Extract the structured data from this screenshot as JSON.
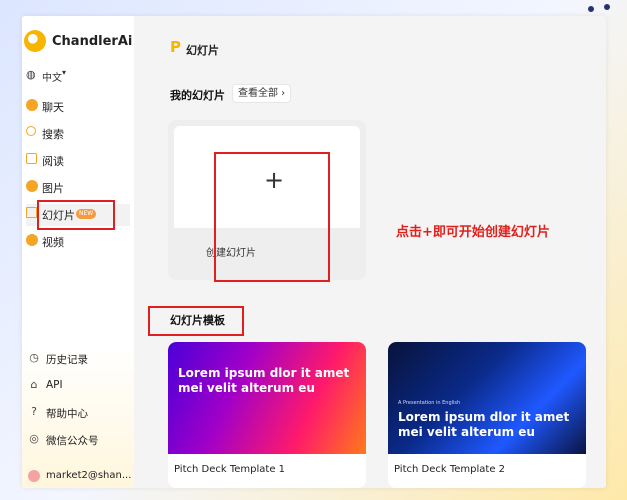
{
  "app": {
    "name": "ChandlerAi",
    "language": "中文"
  },
  "sidebar": {
    "items": [
      {
        "label": "聊天",
        "icon": "chat-icon"
      },
      {
        "label": "搜索",
        "icon": "search-icon"
      },
      {
        "label": "阅读",
        "icon": "book-icon"
      },
      {
        "label": "图片",
        "icon": "image-icon"
      },
      {
        "label": "幻灯片",
        "icon": "slides-icon",
        "badge": "NEW"
      },
      {
        "label": "视频",
        "icon": "video-icon"
      }
    ],
    "bottom": [
      {
        "label": "历史记录",
        "icon": "history-icon"
      },
      {
        "label": "API",
        "icon": "api-icon"
      },
      {
        "label": "帮助中心",
        "icon": "help-icon"
      },
      {
        "label": "微信公众号",
        "icon": "wechat-icon"
      }
    ],
    "user": "market2@shan..."
  },
  "main": {
    "title": "幻灯片",
    "my_section": "我的幻灯片",
    "view_all": "查看全部 ›",
    "create_label": "创建幻灯片",
    "hint": "点击+即可开始创建幻灯片",
    "templates_section": "幻灯片模板",
    "templates": [
      {
        "heading": "Lorem ipsum dlor it amet mei velit alterum eu",
        "name": "Pitch Deck Template 1"
      },
      {
        "kicker": "A Presentation in English",
        "heading": "Lorem ipsum dlor it amet mei velit alterum eu",
        "name": "Pitch Deck Template 2"
      }
    ]
  },
  "colors": {
    "accent": "#f5a524",
    "annotation": "#e0201b"
  }
}
